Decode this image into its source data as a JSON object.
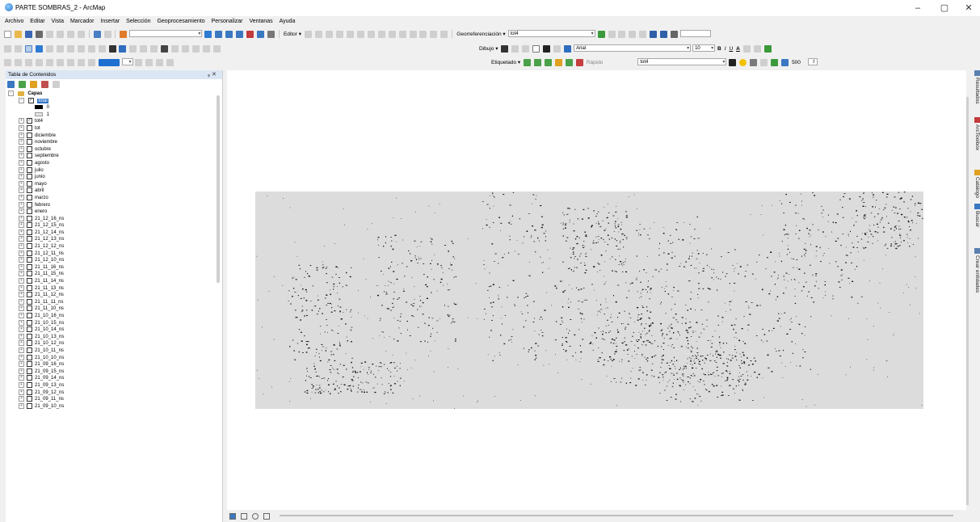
{
  "window": {
    "title": "PARTE SOMBRAS_2 - ArcMap",
    "controls": {
      "minimize": "–",
      "maximize": "▢",
      "close": "✕"
    }
  },
  "menu": [
    "Archivo",
    "Editar",
    "Vista",
    "Marcador",
    "Insertar",
    "Selección",
    "Geoprocesamiento",
    "Personalizar",
    "Ventanas",
    "Ayuda"
  ],
  "toolbars": {
    "editor_label": "Editor ▾",
    "georef_label": "Georreferenciación ▾",
    "georef_layer": "tot4",
    "dibujo_label": "Dibujo ▾",
    "font_name": "Arial",
    "font_size": "10",
    "etiquetado_label": "Etiquetado ▾",
    "rapido_label": "Rápido",
    "layer_combo": "tot4",
    "scale_value": "500",
    "bold": "B",
    "italic": "I",
    "underline": "U",
    "font_color": "A"
  },
  "toc": {
    "title": "Tabla de Contenidos",
    "pin": "ᵩ ✕",
    "root": "Capas",
    "selected_layer": "total",
    "legend": [
      "0",
      "1"
    ],
    "layers": [
      "tot4",
      "tot",
      "diciembre",
      "noviembre",
      "octubre",
      "septiembre",
      "agosto",
      "julio",
      "junio",
      "mayo",
      "abril",
      "marzo",
      "febrero",
      "enero",
      "21_12_16_ns",
      "21_12_15_ns",
      "21_12_14_ns",
      "21_12_13_ns",
      "21_12_12_ns",
      "21_12_11_ns",
      "21_12_10_ns",
      "21_11_16_ns",
      "21_11_15_ns",
      "21_11_14_ns",
      "21_11_13_ns",
      "21_11_12_ns",
      "21_11_11_ns",
      "21_11_10_ns",
      "21_10_16_ns",
      "21_10_15_ns",
      "21_10_14_ns",
      "21_10_13_ns",
      "21_10_12_ns",
      "21_10_11_ns",
      "21_10_10_ns",
      "21_09_16_ns",
      "21_09_15_ns",
      "21_09_14_ns",
      "21_09_13_ns",
      "21_09_12_ns",
      "21_09_11_ns",
      "21_09_10_ns"
    ],
    "checked": [
      "tot4"
    ]
  },
  "right_dock": [
    "Resultados",
    "ArcToolbox",
    "Catálogo",
    "Buscar",
    "Crear entidades"
  ],
  "colors": {
    "selection": "#3174c8",
    "raster_bg": "#dcdcdc",
    "toc_header": "#dbe6f4"
  }
}
